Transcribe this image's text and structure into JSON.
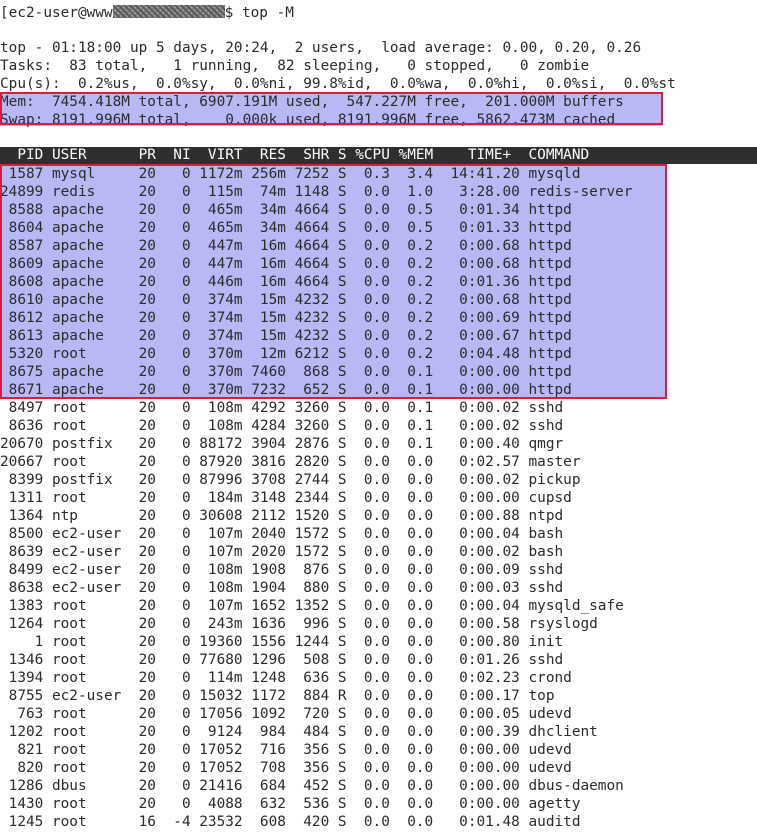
{
  "prompt": {
    "user": "[ec2-user@www",
    "symbol": "$",
    "command": "top -M"
  },
  "summary": {
    "line_top": "top - 01:18:00 up 5 days, 20:24,  2 users,  load average: 0.00, 0.20, 0.26",
    "line_tasks": "Tasks:  83 total,   1 running,  82 sleeping,   0 stopped,   0 zombie",
    "line_cpu": "Cpu(s):  0.2%us,  0.0%sy,  0.0%ni, 99.8%id,  0.0%wa,  0.0%hi,  0.0%si,  0.0%st",
    "line_mem": "Mem:  7454.418M total, 6907.191M used,  547.227M free,  201.000M buffers",
    "line_swap": "Swap: 8191.996M total,    0.000k used, 8191.996M free, 5862.473M cached"
  },
  "table_header": "  PID USER      PR  NI  VIRT  RES  SHR S %CPU %MEM    TIME+  COMMAND",
  "processes": [
    {
      "line": " 1587 mysql     20   0 1172m 256m 7252 S  0.3  3.4  14:41.20 mysqld"
    },
    {
      "line": "24899 redis     20   0  115m  74m 1148 S  0.0  1.0   3:28.00 redis-server"
    },
    {
      "line": " 8588 apache    20   0  465m  34m 4664 S  0.0  0.5   0:01.34 httpd"
    },
    {
      "line": " 8604 apache    20   0  465m  34m 4664 S  0.0  0.5   0:01.33 httpd"
    },
    {
      "line": " 8587 apache    20   0  447m  16m 4664 S  0.0  0.2   0:00.68 httpd"
    },
    {
      "line": " 8609 apache    20   0  447m  16m 4664 S  0.0  0.2   0:00.68 httpd"
    },
    {
      "line": " 8608 apache    20   0  446m  16m 4664 S  0.0  0.2   0:01.36 httpd"
    },
    {
      "line": " 8610 apache    20   0  374m  15m 4232 S  0.0  0.2   0:00.68 httpd"
    },
    {
      "line": " 8612 apache    20   0  374m  15m 4232 S  0.0  0.2   0:00.69 httpd"
    },
    {
      "line": " 8613 apache    20   0  374m  15m 4232 S  0.0  0.2   0:00.67 httpd"
    },
    {
      "line": " 5320 root      20   0  370m  12m 6212 S  0.0  0.2   0:04.48 httpd"
    },
    {
      "line": " 8675 apache    20   0  370m 7460  868 S  0.0  0.1   0:00.00 httpd"
    },
    {
      "line": " 8671 apache    20   0  370m 7232  652 S  0.0  0.1   0:00.00 httpd"
    },
    {
      "line": " 8497 root      20   0  108m 4292 3260 S  0.0  0.1   0:00.02 sshd"
    },
    {
      "line": " 8636 root      20   0  108m 4284 3260 S  0.0  0.1   0:00.02 sshd"
    },
    {
      "line": "20670 postfix   20   0 88172 3904 2876 S  0.0  0.1   0:00.40 qmgr"
    },
    {
      "line": "20667 root      20   0 87920 3816 2820 S  0.0  0.0   0:02.57 master"
    },
    {
      "line": " 8399 postfix   20   0 87996 3708 2744 S  0.0  0.0   0:00.02 pickup"
    },
    {
      "line": " 1311 root      20   0  184m 3148 2344 S  0.0  0.0   0:00.00 cupsd"
    },
    {
      "line": " 1364 ntp       20   0 30608 2112 1520 S  0.0  0.0   0:00.88 ntpd"
    },
    {
      "line": " 8500 ec2-user  20   0  107m 2040 1572 S  0.0  0.0   0:00.04 bash"
    },
    {
      "line": " 8639 ec2-user  20   0  107m 2020 1572 S  0.0  0.0   0:00.02 bash"
    },
    {
      "line": " 8499 ec2-user  20   0  108m 1908  876 S  0.0  0.0   0:00.09 sshd"
    },
    {
      "line": " 8638 ec2-user  20   0  108m 1904  880 S  0.0  0.0   0:00.03 sshd"
    },
    {
      "line": " 1383 root      20   0  107m 1652 1352 S  0.0  0.0   0:00.04 mysqld_safe"
    },
    {
      "line": " 1264 root      20   0  243m 1636  996 S  0.0  0.0   0:00.58 rsyslogd"
    },
    {
      "line": "    1 root      20   0 19360 1556 1244 S  0.0  0.0   0:00.80 init"
    },
    {
      "line": " 1346 root      20   0 77680 1296  508 S  0.0  0.0   0:01.26 sshd"
    },
    {
      "line": " 1394 root      20   0  114m 1248  636 S  0.0  0.0   0:02.23 crond"
    },
    {
      "line": " 8755 ec2-user  20   0 15032 1172  884 R  0.0  0.0   0:00.17 top"
    },
    {
      "line": "  763 root      20   0 17056 1092  720 S  0.0  0.0   0:00.05 udevd"
    },
    {
      "line": " 1202 root      20   0  9124  984  484 S  0.0  0.0   0:00.39 dhclient"
    },
    {
      "line": "  821 root      20   0 17052  716  356 S  0.0  0.0   0:00.00 udevd"
    },
    {
      "line": "  820 root      20   0 17052  708  356 S  0.0  0.0   0:00.00 udevd"
    },
    {
      "line": " 1286 dbus      20   0 21416  684  452 S  0.0  0.0   0:00.00 dbus-daemon"
    },
    {
      "line": " 1430 root      20   0  4088  632  536 S  0.0  0.0   0:00.00 agetty"
    },
    {
      "line": " 1245 root      16  -4 23532  608  420 S  0.0  0.0   0:01.48 auditd"
    }
  ],
  "colors": {
    "background": "#ffffff",
    "text": "#2b2b2b",
    "header_bar": "#2f2f2f",
    "highlight": "#b8b8f5",
    "annotation_border": "#dc1c3c"
  }
}
